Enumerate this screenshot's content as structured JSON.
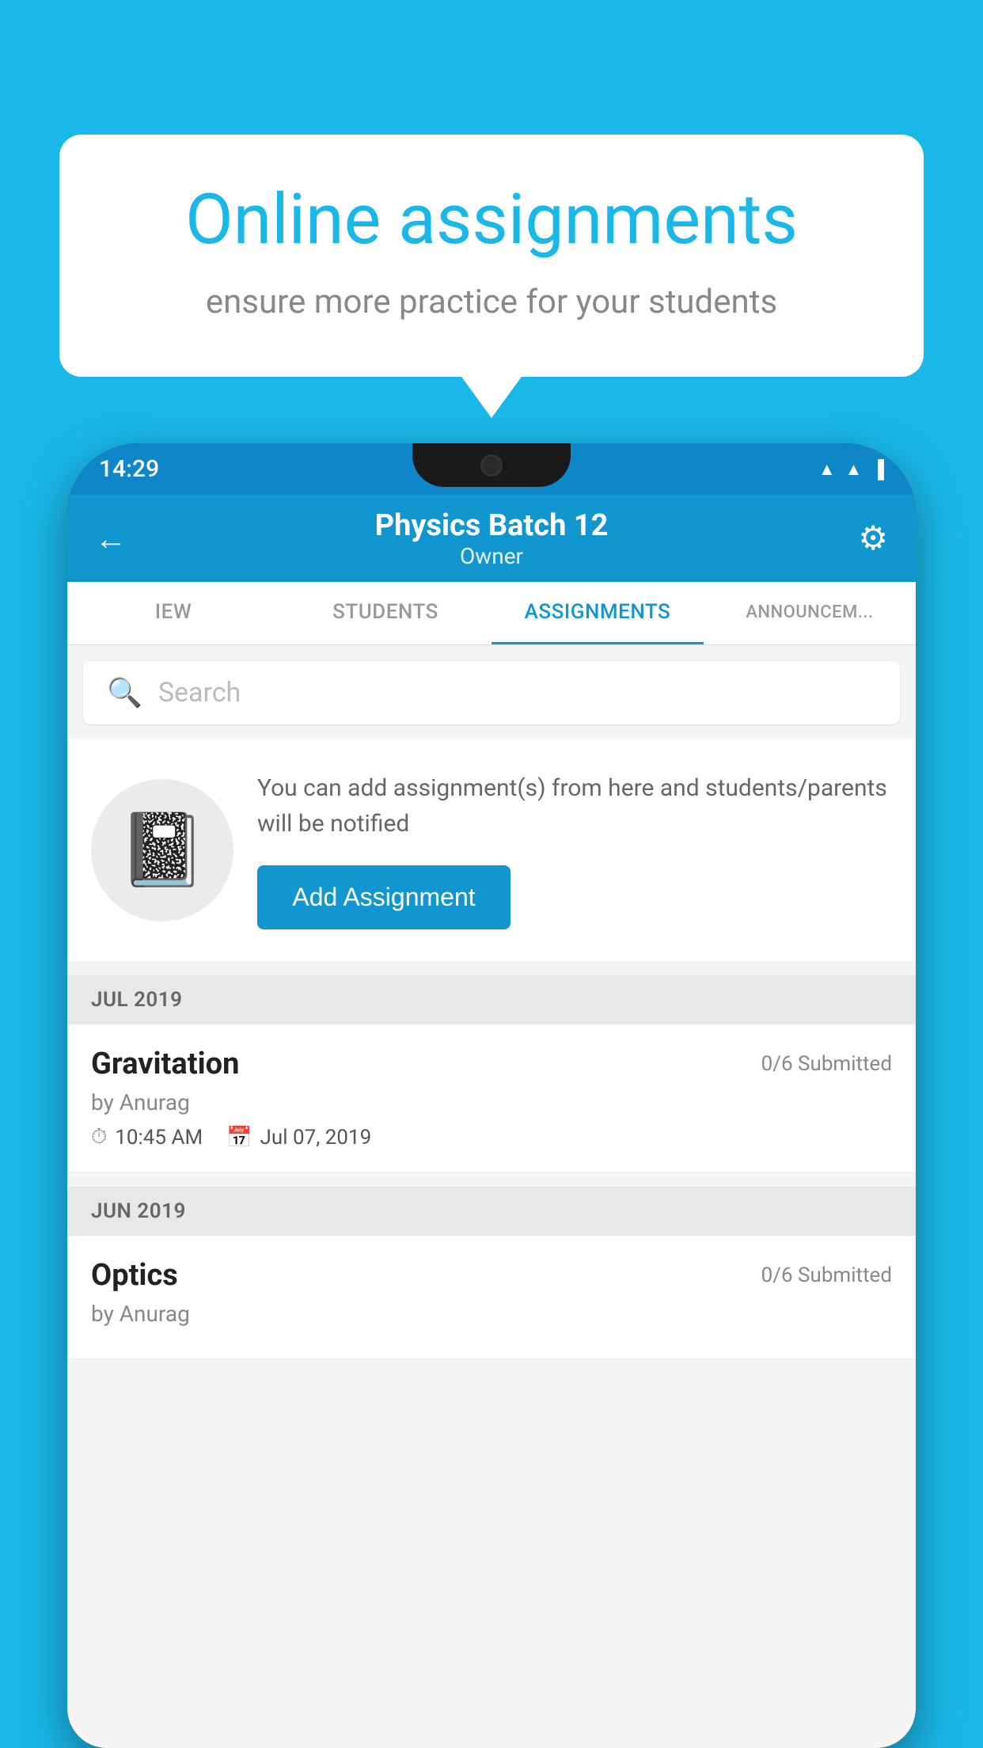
{
  "background": {
    "color": "#1ab8e8"
  },
  "speech_bubble": {
    "title": "Online assignments",
    "subtitle": "ensure more practice for your students"
  },
  "status_bar": {
    "time": "14:29",
    "icons": [
      "wifi",
      "signal",
      "battery"
    ]
  },
  "header": {
    "title": "Physics Batch 12",
    "subtitle": "Owner",
    "back_label": "←",
    "settings_label": "⚙"
  },
  "tabs": [
    {
      "label": "IEW",
      "active": false
    },
    {
      "label": "STUDENTS",
      "active": false
    },
    {
      "label": "ASSIGNMENTS",
      "active": true
    },
    {
      "label": "ANNOUNCEM...",
      "active": false
    }
  ],
  "search": {
    "placeholder": "Search"
  },
  "info_card": {
    "description": "You can add assignment(s) from here and students/parents will be notified",
    "button_label": "Add Assignment"
  },
  "sections": [
    {
      "month": "JUL 2019",
      "assignments": [
        {
          "name": "Gravitation",
          "submitted": "0/6 Submitted",
          "author": "by Anurag",
          "time": "10:45 AM",
          "date": "Jul 07, 2019"
        }
      ]
    },
    {
      "month": "JUN 2019",
      "assignments": [
        {
          "name": "Optics",
          "submitted": "0/6 Submitted",
          "author": "by Anurag",
          "time": "",
          "date": ""
        }
      ]
    }
  ]
}
